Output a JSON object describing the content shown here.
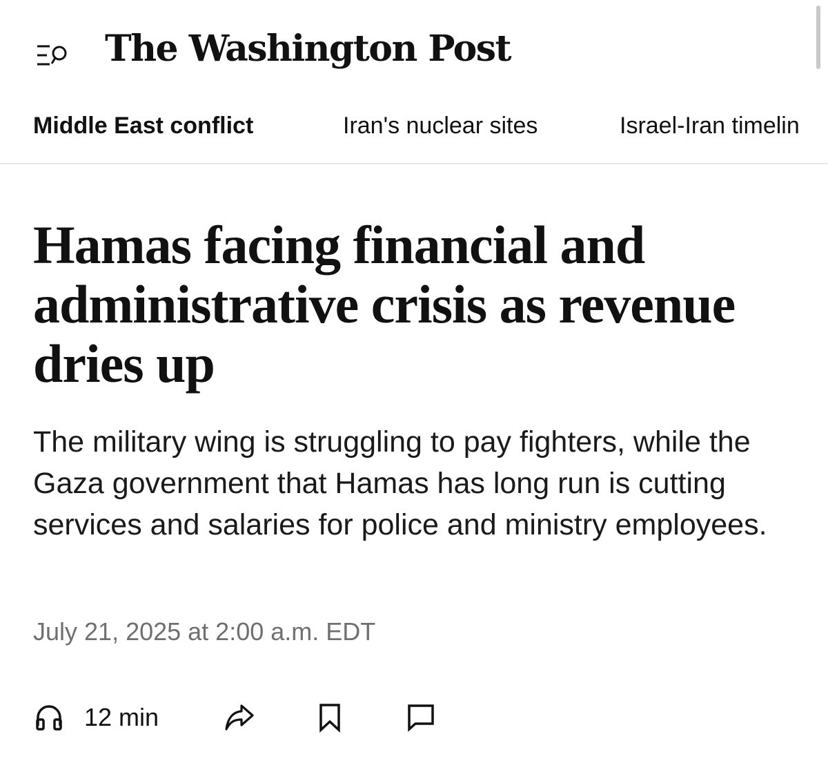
{
  "header": {
    "masthead": "The Washington Post",
    "menu_icon": "menu-search-icon"
  },
  "subnav": {
    "items": [
      {
        "label": "Middle East conflict",
        "active": true
      },
      {
        "label": "Iran's nuclear sites",
        "active": false
      },
      {
        "label": "Israel-Iran timelin",
        "active": false
      }
    ]
  },
  "article": {
    "headline": "Hamas facing financial and administrative crisis as revenue dries up",
    "dek": "The military wing is struggling to pay fighters, while the Gaza government that Hamas has long run is cutting services and salaries for police and ministry employees.",
    "timestamp": "July 21, 2025 at 2:00 a.m. EDT"
  },
  "actions": {
    "listen": {
      "label": "12 min",
      "icon": "headphones-icon"
    },
    "share": {
      "icon": "share-icon"
    },
    "save": {
      "icon": "bookmark-icon"
    },
    "comments": {
      "icon": "comment-icon"
    }
  },
  "colors": {
    "text": "#111111",
    "muted": "#6f6f6f",
    "divider": "#e8e8e8"
  }
}
